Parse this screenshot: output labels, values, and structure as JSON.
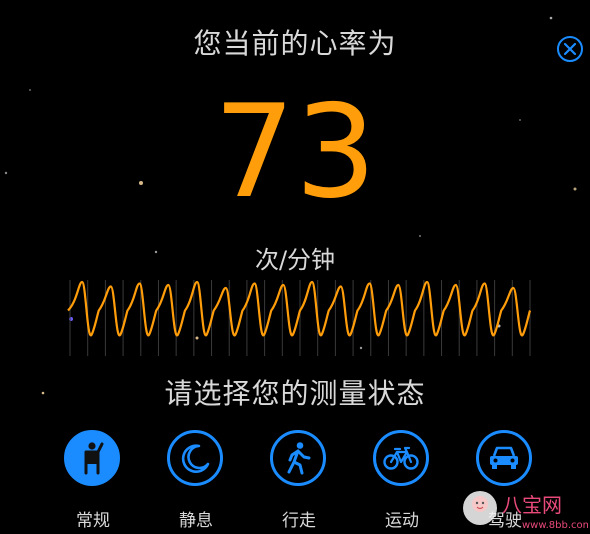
{
  "header": {
    "title": "您当前的心率为"
  },
  "heart_rate": {
    "value": "73",
    "unit": "次/分钟"
  },
  "waveform": {
    "peaks": 16,
    "color": "#ff9d0a"
  },
  "state_prompt": "请选择您的测量状态",
  "modes": [
    {
      "label": "常规",
      "icon": "standing-person-icon",
      "active": true
    },
    {
      "label": "静息",
      "icon": "moon-icon",
      "active": false
    },
    {
      "label": "行走",
      "icon": "walking-person-icon",
      "active": false
    },
    {
      "label": "运动",
      "icon": "bicycle-icon",
      "active": false
    },
    {
      "label": "驾驶",
      "icon": "car-icon",
      "active": false
    }
  ],
  "watermark": {
    "brand": "八宝网",
    "url": "www.8bb.com"
  },
  "colors": {
    "accent": "#1a8cff",
    "value": "#ff9d0a",
    "background": "#000000"
  }
}
